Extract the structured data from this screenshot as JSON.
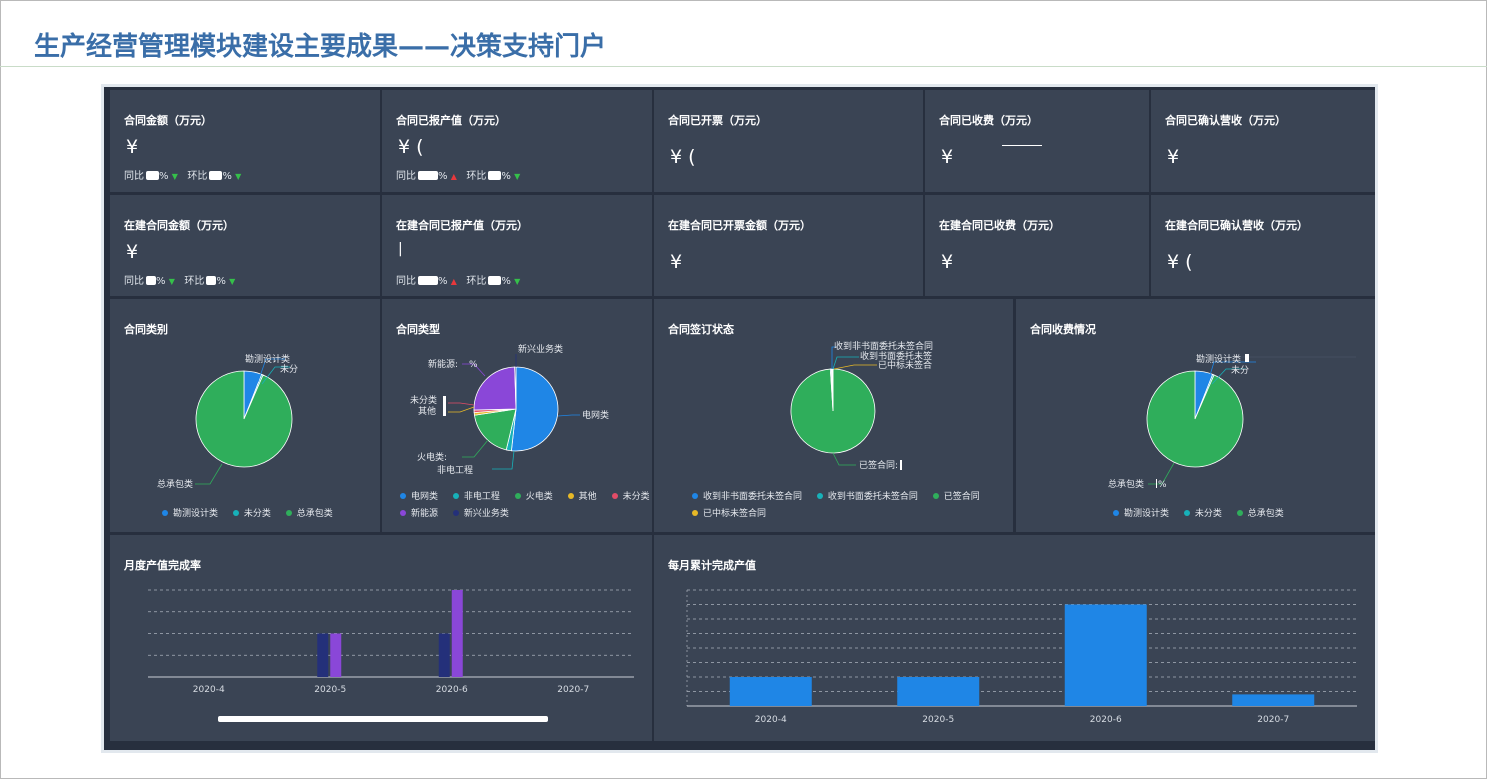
{
  "page_title": "生产经营管理模块建设主要成果——决策支持门户",
  "kpi_row1": [
    {
      "title": "合同金额（万元）",
      "value": "¥",
      "yoy_label": "同比",
      "yoy_unit": "%",
      "yoy_trend": "down",
      "mom_label": "环比",
      "mom_unit": "%",
      "mom_trend": "down"
    },
    {
      "title": "合同已报产值（万元）",
      "value": "¥ (",
      "yoy_label": "同比",
      "yoy_unit": "%",
      "yoy_trend": "up",
      "mom_label": "环比",
      "mom_unit": "%",
      "mom_trend": "down"
    },
    {
      "title": "合同已开票（万元）",
      "value": "¥ ("
    },
    {
      "title": "合同已收费（万元）",
      "value": "¥"
    },
    {
      "title": "合同已确认营收（万元）",
      "value": "¥"
    }
  ],
  "kpi_row2": [
    {
      "title": "在建合同金额（万元）",
      "value": "¥",
      "yoy_label": "同比",
      "yoy_unit": "%",
      "yoy_trend": "down",
      "mom_label": "环比",
      "mom_unit": "%",
      "mom_trend": "down"
    },
    {
      "title": "在建合同已报产值（万元）",
      "value": "|",
      "yoy_label": "同比",
      "yoy_unit": "%",
      "yoy_trend": "up",
      "mom_label": "环比",
      "mom_unit": "%",
      "mom_trend": "down"
    },
    {
      "title": "在建合同已开票金额（万元）",
      "value": "¥"
    },
    {
      "title": "在建合同已收费（万元）",
      "value": "¥"
    },
    {
      "title": "在建合同已确认营收（万元）",
      "value": "¥ ("
    }
  ],
  "colors": {
    "blue": "#1f86e6",
    "teal": "#17b1b9",
    "green": "#2fae5b",
    "yellow": "#e7b927",
    "red": "#e24c67",
    "purple": "#8a47d8",
    "navy": "#24307a",
    "panel": "#3a4454",
    "page_title": "#3a6ea8"
  },
  "pie_category": {
    "title": "合同类别",
    "labels": {
      "a": "勘测设计类",
      "b": "未分",
      "c": "总承包类"
    },
    "legend": [
      "勘测设计类",
      "未分类",
      "总承包类"
    ],
    "chart_data": {
      "type": "pie",
      "slices": [
        {
          "name": "勘测设计类",
          "value": 6
        },
        {
          "name": "未分类",
          "value": 0.5
        },
        {
          "name": "总承包类",
          "value": 93.5
        }
      ]
    }
  },
  "pie_type": {
    "title": "合同类型",
    "labels": {
      "new_biz": "新兴业务类",
      "new_energy": "新能源:",
      "pct": "%",
      "unclassified": "未分类",
      "other": "其他",
      "grid": "电网类",
      "hydro": "火电类:",
      "nongrid": "非电工程"
    },
    "legend_row1": [
      "电网类",
      "非电工程",
      "火电类",
      "其他",
      "未分类"
    ],
    "legend_row2": [
      "新能源",
      "新兴业务类"
    ],
    "chart_data": {
      "type": "pie",
      "slices": [
        {
          "name": "电网类",
          "value": 52
        },
        {
          "name": "非电工程",
          "value": 2
        },
        {
          "name": "火电类",
          "value": 19
        },
        {
          "name": "其他",
          "value": 1
        },
        {
          "name": "未分类",
          "value": 1
        },
        {
          "name": "新能源",
          "value": 25
        },
        {
          "name": "新兴业务类",
          "value": 0.5
        }
      ]
    }
  },
  "pie_sign": {
    "title": "合同签订状态",
    "labels": {
      "a": "收到非书面委托未签合同",
      "b": "收到书面委托未签",
      "c": "已中标未签合",
      "d": "已签合同:"
    },
    "legend_row1": [
      "收到非书面委托未签合同",
      "收到书面委托未签合同",
      "已签合同"
    ],
    "legend_row2": [
      "已中标未签合同"
    ],
    "chart_data": {
      "type": "pie",
      "slices": [
        {
          "name": "已签合同",
          "value": 99
        },
        {
          "name": "收到非书面委托未签合同",
          "value": 0.4
        },
        {
          "name": "收到书面委托未签合同",
          "value": 0.3
        },
        {
          "name": "已中标未签合同",
          "value": 0.3
        }
      ]
    }
  },
  "pie_fee": {
    "title": "合同收费情况",
    "labels": {
      "a": "勘测设计类",
      "b": "未分",
      "c": "总承包类",
      "pct": "%"
    },
    "legend": [
      "勘测设计类",
      "未分类",
      "总承包类"
    ],
    "chart_data": {
      "type": "pie",
      "slices": [
        {
          "name": "勘测设计类",
          "value": 6
        },
        {
          "name": "未分类",
          "value": 0.5
        },
        {
          "name": "总承包类",
          "value": 93.5
        }
      ]
    }
  },
  "bar_rate": {
    "title": "月度产值完成率",
    "chart_data": {
      "type": "bar",
      "categories": [
        "2020-4",
        "2020-5",
        "2020-6",
        "2020-7"
      ],
      "series": [
        {
          "values": [
            0,
            2,
            2,
            0
          ]
        },
        {
          "values": [
            0,
            2,
            4,
            0
          ]
        }
      ],
      "ylim": [
        0,
        4
      ]
    }
  },
  "bar_cum": {
    "title": "每月累计完成产值",
    "chart_data": {
      "type": "bar",
      "categories": [
        "2020-4",
        "2020-5",
        "2020-6",
        "2020-7"
      ],
      "values": [
        2,
        2,
        7,
        0.8
      ],
      "ylim": [
        0,
        8
      ]
    }
  }
}
